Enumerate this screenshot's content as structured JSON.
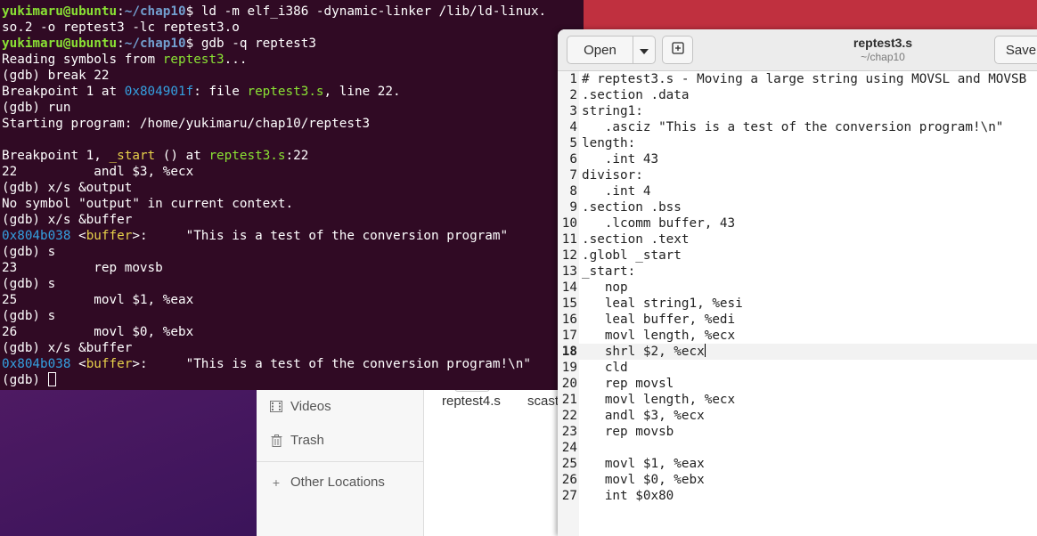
{
  "terminal": {
    "lines": [
      [
        {
          "t": "yukimaru@ubuntu",
          "c": "user"
        },
        {
          "t": ":"
        },
        {
          "t": "~/chap10",
          "c": "path"
        },
        {
          "t": "$ ld -m elf_i386 -dynamic-linker /lib/ld-linux."
        }
      ],
      [
        {
          "t": "so.2 -o reptest3 -lc reptest3.o"
        }
      ],
      [
        {
          "t": "yukimaru@ubuntu",
          "c": "user"
        },
        {
          "t": ":"
        },
        {
          "t": "~/chap10",
          "c": "path"
        },
        {
          "t": "$ gdb -q reptest3"
        }
      ],
      [
        {
          "t": "Reading symbols from "
        },
        {
          "t": "reptest3",
          "c": "green"
        },
        {
          "t": "..."
        }
      ],
      [
        {
          "t": "(gdb) break 22"
        }
      ],
      [
        {
          "t": "Breakpoint 1 at "
        },
        {
          "t": "0x804901f",
          "c": "blue"
        },
        {
          "t": ": file "
        },
        {
          "t": "reptest3.s",
          "c": "green"
        },
        {
          "t": ", line 22."
        }
      ],
      [
        {
          "t": "(gdb) run"
        }
      ],
      [
        {
          "t": "Starting program: /home/yukimaru/chap10/reptest3"
        }
      ],
      [
        {
          "t": ""
        }
      ],
      [
        {
          "t": "Breakpoint 1, "
        },
        {
          "t": "_start",
          "c": "yellow"
        },
        {
          "t": " () at "
        },
        {
          "t": "reptest3.s",
          "c": "green"
        },
        {
          "t": ":22"
        }
      ],
      [
        {
          "t": "22          andl $3, %ecx"
        }
      ],
      [
        {
          "t": "(gdb) x/s &output"
        }
      ],
      [
        {
          "t": "No symbol \"output\" in current context."
        }
      ],
      [
        {
          "t": "(gdb) x/s &buffer"
        }
      ],
      [
        {
          "t": "0x804b038",
          "c": "blue"
        },
        {
          "t": " <"
        },
        {
          "t": "buffer",
          "c": "yellow"
        },
        {
          "t": ">:     \"This is a test of the conversion program\""
        }
      ],
      [
        {
          "t": "(gdb) s"
        }
      ],
      [
        {
          "t": "23          rep movsb"
        }
      ],
      [
        {
          "t": "(gdb) s"
        }
      ],
      [
        {
          "t": "25          movl $1, %eax"
        }
      ],
      [
        {
          "t": "(gdb) s"
        }
      ],
      [
        {
          "t": "26          movl $0, %ebx"
        }
      ],
      [
        {
          "t": "(gdb) x/s &buffer"
        }
      ],
      [
        {
          "t": "0x804b038",
          "c": "blue"
        },
        {
          "t": " <"
        },
        {
          "t": "buffer",
          "c": "yellow"
        },
        {
          "t": ">:     \"This is a test of the conversion program!\\n\""
        }
      ],
      [
        {
          "t": "(gdb) "
        },
        {
          "cursor": true
        }
      ]
    ]
  },
  "files": {
    "sidebar": [
      {
        "label": "Videos",
        "icon": "video-icon"
      },
      {
        "label": "Trash",
        "icon": "trash-icon"
      },
      {
        "label": "Other Locations",
        "icon": "plus-icon"
      }
    ],
    "file_items": [
      "reptest4.s",
      "scast"
    ]
  },
  "gedit": {
    "open_label": "Open",
    "save_label": "Save",
    "title": "reptest3.s",
    "subtitle": "~/chap10",
    "current_line": 18,
    "lines": [
      "# reptest3.s - Moving a large string using MOVSL and MOVSB",
      ".section .data",
      "string1:",
      "   .asciz \"This is a test of the conversion program!\\n\"",
      "length:",
      "   .int 43",
      "divisor:",
      "   .int 4",
      ".section .bss",
      "   .lcomm buffer, 43",
      ".section .text",
      ".globl _start",
      "_start:",
      "   nop",
      "   leal string1, %esi",
      "   leal buffer, %edi",
      "   movl length, %ecx",
      "   shrl $2, %ecx",
      "   cld",
      "   rep movsl",
      "   movl length, %ecx",
      "   andl $3, %ecx",
      "   rep movsb",
      "",
      "   movl $1, %eax",
      "   movl $0, %ebx",
      "   int $0x80"
    ]
  }
}
